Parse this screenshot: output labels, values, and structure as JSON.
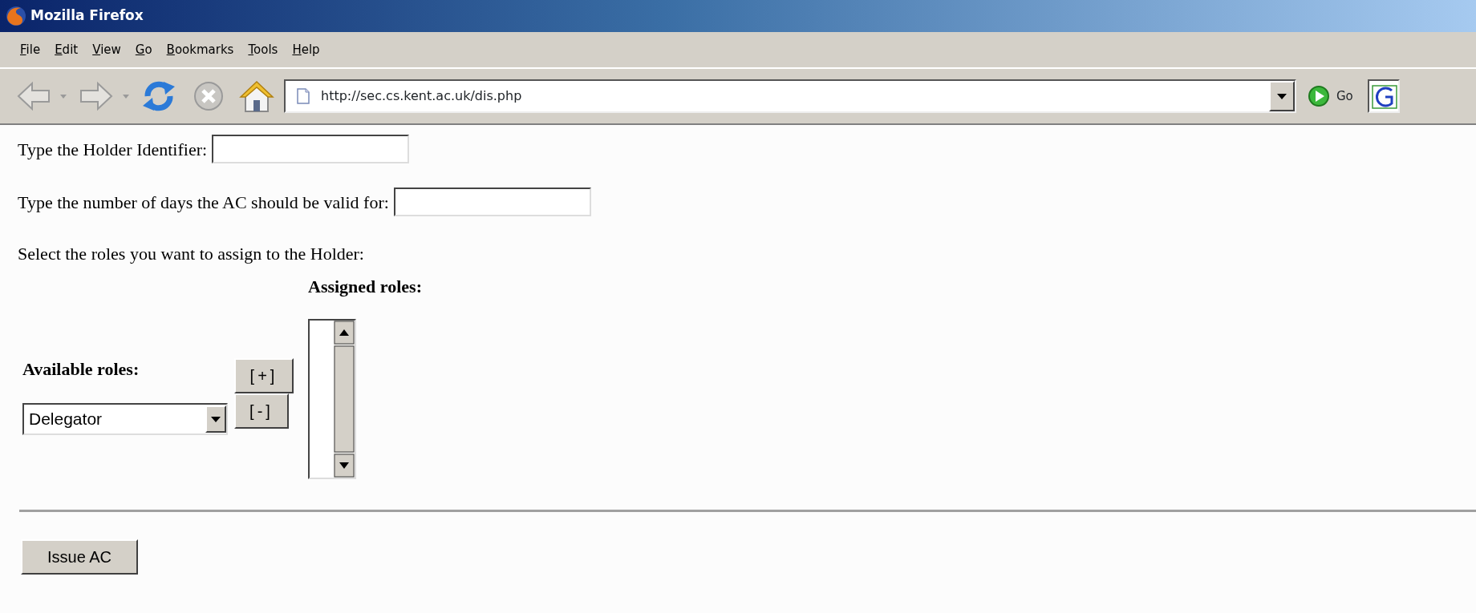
{
  "window": {
    "title": "Mozilla Firefox"
  },
  "menu": [
    {
      "label": "File"
    },
    {
      "label": "Edit"
    },
    {
      "label": "View"
    },
    {
      "label": "Go"
    },
    {
      "label": "Bookmarks"
    },
    {
      "label": "Tools"
    },
    {
      "label": "Help"
    }
  ],
  "toolbar": {
    "address": "http://sec.cs.kent.ac.uk/dis.php",
    "go_label": "Go"
  },
  "form": {
    "fields": [
      {
        "label": "Type the Holder Identifier:"
      },
      {
        "label": "Type the number of days the AC should be valid for:"
      }
    ],
    "roles_prompt": "Select the roles you want to assign to the Holder:",
    "assigned_heading": "Assigned roles:",
    "available_heading": "Available roles:",
    "available_value": "Delegator",
    "add_button": "[+]",
    "remove_button": "[-]",
    "submit_button": "Issue AC"
  }
}
